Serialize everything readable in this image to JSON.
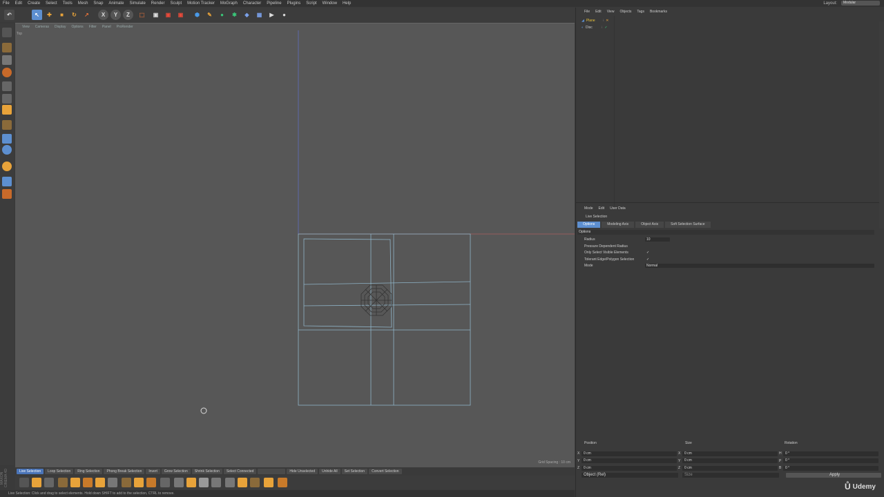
{
  "menu": [
    "File",
    "Edit",
    "Create",
    "Select",
    "Tools",
    "Mesh",
    "Snap",
    "Animate",
    "Simulate",
    "Render",
    "Sculpt",
    "Motion Tracker",
    "MoGraph",
    "Character",
    "Pipeline",
    "Plugins",
    "Script",
    "Window",
    "Help"
  ],
  "layout": {
    "label": "Layout:",
    "value": "Modular"
  },
  "toolbar_axes": [
    "X",
    "Y",
    "Z"
  ],
  "viewport": {
    "menu": [
      "View",
      "Cameras",
      "Display",
      "Options",
      "Filter",
      "Panel",
      "ProRender"
    ],
    "label": "Top",
    "grid_info": "Grid Spacing : 10 cm"
  },
  "selection_bar": [
    "Live Selection",
    "Loop Selection",
    "Ring Selection",
    "Phong Break Selection",
    "Invert",
    "Grow Selection",
    "Shrink Selection",
    "Select Connected",
    "",
    "Hide Unselected",
    "Unhide All",
    "Set Selection",
    "Convert Selection"
  ],
  "status": "Live Selection: Click and drag to select elements. Hold down SHIFT to add to the selection, CTRL to remove.",
  "brand": "MAXON CINEMA 4D",
  "objects": {
    "menu": [
      "File",
      "Edit",
      "View",
      "Objects",
      "Tags",
      "Bookmarks"
    ],
    "items": [
      {
        "name": "Plane"
      },
      {
        "name": "Disc"
      }
    ]
  },
  "attributes": {
    "menu": [
      "Mode",
      "Edit",
      "User Data"
    ],
    "title": "Live Selection",
    "tabs": [
      "Options",
      "Modeling Axis",
      "Object Axis",
      "Soft Selection Surface"
    ],
    "section": "Options",
    "props": [
      {
        "label": "Radius",
        "value": "10"
      },
      {
        "label": "Pressure Dependent Radius",
        "value": ""
      },
      {
        "label": "Only Select Visible Elements",
        "value": "✓"
      },
      {
        "label": "Tolerant Edge/Polygon Selection",
        "value": "✓"
      },
      {
        "label": "Mode",
        "value": "Normal"
      }
    ]
  },
  "coordinates": {
    "headers": [
      "Position",
      "Size",
      "Rotation"
    ],
    "rows": [
      {
        "axis": "X",
        "pos": "0 cm",
        "size_axis": "X",
        "size": "0 cm",
        "rot_axis": "H",
        "rot": "0 °"
      },
      {
        "axis": "Y",
        "pos": "0 cm",
        "size_axis": "Y",
        "size": "0 cm",
        "rot_axis": "P",
        "rot": "0 °"
      },
      {
        "axis": "Z",
        "pos": "0 cm",
        "size_axis": "Z",
        "size": "0 cm",
        "rot_axis": "B",
        "rot": "0 °"
      }
    ],
    "mode": "Object (Rel)",
    "size_mode": "Size",
    "apply": "Apply"
  },
  "watermark": "Udemy",
  "colors": {
    "accent": "#5d8fd0",
    "viewport": "#575757",
    "wire": "#8fb4c8"
  }
}
